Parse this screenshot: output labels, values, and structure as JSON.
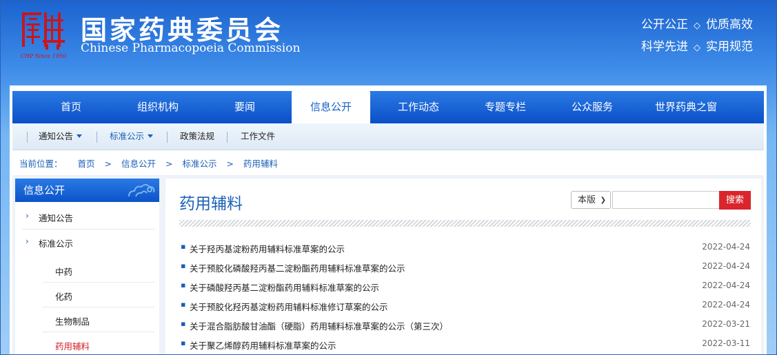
{
  "header": {
    "logo_text": "CHP Since 1950",
    "title": "国家药典委员会",
    "subtitle": "Chinese Pharmacopoeia Commission",
    "slogan": [
      [
        "公开公正",
        "优质高效"
      ],
      [
        "科学先进",
        "实用规范"
      ]
    ],
    "slogan_sep": "◇"
  },
  "nav": {
    "items": [
      "首页",
      "组织机构",
      "要闻",
      "信息公开",
      "工作动态",
      "专题专栏",
      "公众服务",
      "世界药典之窗"
    ],
    "active": "信息公开"
  },
  "subnav": {
    "items": [
      "通知公告",
      "标准公示",
      "政策法规",
      "工作文件"
    ]
  },
  "breadcrumb": {
    "label": "当前位置：",
    "items": [
      "首页",
      "信息公开",
      "标准公示",
      "药用辅料"
    ],
    "sep": ">"
  },
  "sidebar": {
    "title": "信息公开",
    "items": [
      "通知公告",
      "标准公示"
    ],
    "children": [
      "中药",
      "化药",
      "生物制品",
      "药用辅料"
    ],
    "active_child": "药用辅料",
    "arrow": "›"
  },
  "content": {
    "title": "药用辅料",
    "search": {
      "scope": "本版",
      "button": "搜索",
      "placeholder": ""
    },
    "bullet": "▪",
    "list": [
      {
        "title": "关于羟丙基淀粉药用辅料标准草案的公示",
        "date": "2022-04-24"
      },
      {
        "title": "关于预胶化磷酸羟丙基二淀粉酯药用辅料标准草案的公示",
        "date": "2022-04-24"
      },
      {
        "title": "关于磷酸羟丙基二淀粉酯药用辅料标准草案的公示",
        "date": "2022-04-24"
      },
      {
        "title": "关于预胶化羟丙基淀粉药用辅料标准修订草案的公示",
        "date": "2022-04-24"
      },
      {
        "title": "关于混合脂肪酸甘油酯（硬脂）药用辅料标准草案的公示（第三次）",
        "date": "2022-03-21"
      },
      {
        "title": "关于聚乙烯醇药用辅料标准草案的公示",
        "date": "2022-03-11"
      }
    ]
  },
  "colors": {
    "brand_blue": "#1a5fb8",
    "nav_blue": "#0a4fc7",
    "accent_red": "#d9252b",
    "seal_red": "#c8161d"
  }
}
